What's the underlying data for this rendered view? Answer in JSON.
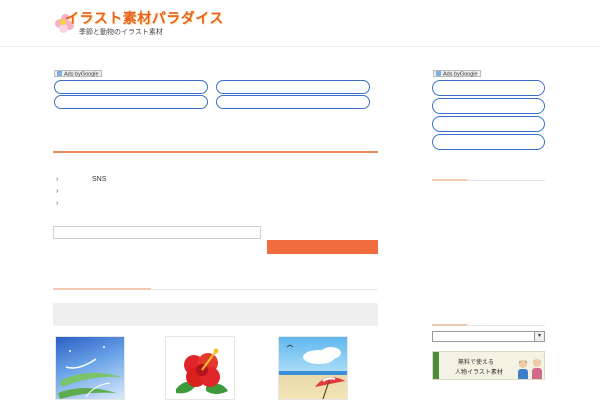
{
  "header": {
    "site_title": "イラスト素材パラダイス",
    "site_subtitle": "季節と動物のイラスト素材"
  },
  "ads": {
    "label_main": "Ads byGoogle",
    "label_side": "Ads byGoogle",
    "main_links": [
      "　　　　　　　　　　",
      "　　　　　　　　　　　",
      "　　　　　　　　　　",
      "　　　　　　"
    ],
    "side_links": [
      "　　　　　　　　",
      "　　　　　",
      "　　　　　",
      "　　　　　"
    ]
  },
  "main": {
    "list_items": [
      {
        "chevron": "›",
        "text": "SNS"
      },
      {
        "chevron": "›",
        "text": ""
      },
      {
        "chevron": "›",
        "text": ""
      }
    ],
    "search": {
      "value": "",
      "placeholder": "",
      "button_label": ""
    }
  },
  "sidebar": {
    "select_value": "",
    "select_arrow": "▾",
    "banner": {
      "line1": "無料で使える",
      "line2": "人物イラスト素材"
    }
  },
  "colors": {
    "accent": "#f26d3d",
    "ad_border": "#3b70c8",
    "rule_orange": "#e88a56"
  }
}
